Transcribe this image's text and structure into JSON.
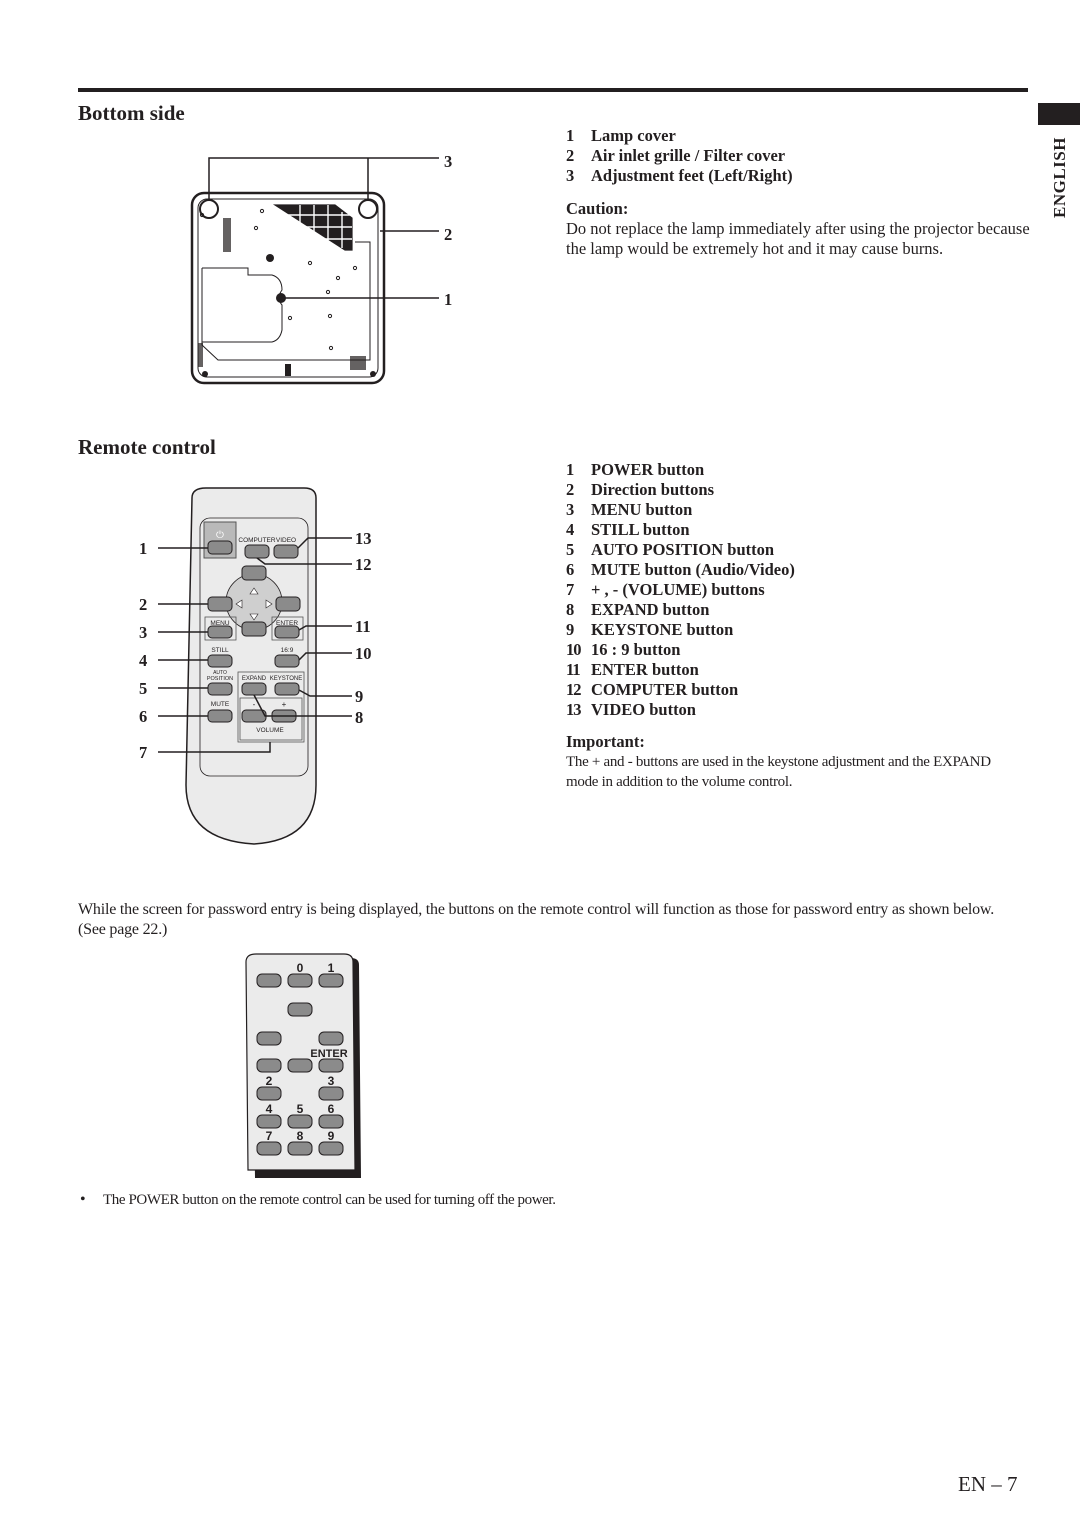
{
  "language_tab": "ENGLISH",
  "bottom_side": {
    "heading": "Bottom side",
    "callouts": [
      "1",
      "2",
      "3"
    ],
    "items": [
      {
        "num": "1",
        "label": "Lamp cover"
      },
      {
        "num": "2",
        "label": "Air inlet grille / Filter cover"
      },
      {
        "num": "3",
        "label": "Adjustment feet (Left/Right)"
      }
    ],
    "caution_heading": "Caution:",
    "caution_text": "Do not replace the lamp immediately after using the projector because the lamp would be extremely hot and it may cause burns."
  },
  "remote_control": {
    "heading": "Remote control",
    "left_callouts": [
      "1",
      "2",
      "3",
      "4",
      "5",
      "6",
      "7"
    ],
    "right_callouts": [
      "13",
      "12",
      "11",
      "10",
      "9",
      "8"
    ],
    "button_labels": {
      "computer": "COMPUTER",
      "video": "VIDEO",
      "menu": "MENU",
      "enter": "ENTER",
      "still": "STILL",
      "aspect": "16:9",
      "auto": "AUTO",
      "position": "POSITION",
      "expand": "EXPAND",
      "keystone": "KEYSTONE",
      "mute": "MUTE",
      "minus": "-",
      "plus": "+",
      "volume": "VOLUME"
    },
    "items": [
      {
        "num": "1",
        "label": "POWER button"
      },
      {
        "num": "2",
        "label": "Direction buttons"
      },
      {
        "num": "3",
        "label": "MENU button"
      },
      {
        "num": "4",
        "label": "STILL button"
      },
      {
        "num": "5",
        "label": "AUTO POSITION button"
      },
      {
        "num": "6",
        "label": "MUTE button (Audio/Video)"
      },
      {
        "num": "7",
        "label": "+ , - (VOLUME) buttons"
      },
      {
        "num": "8",
        "label": "EXPAND button"
      },
      {
        "num": "9",
        "label": "KEYSTONE button"
      },
      {
        "num": "10",
        "label": "16 : 9 button"
      },
      {
        "num": "11",
        "label": "ENTER button"
      },
      {
        "num": "12",
        "label": "COMPUTER button"
      },
      {
        "num": "13",
        "label": "VIDEO button"
      }
    ],
    "important_heading": "Important:",
    "important_text": "The + and - buttons are used in the keystone adjustment and the EXPAND mode in addition to the volume control."
  },
  "password": {
    "intro": "While the screen for password entry is being displayed, the buttons on the remote control will function as those for password entry as shown below. (See page 22.)",
    "keys": {
      "k0": "0",
      "k1": "1",
      "enter": "ENTER",
      "k2": "2",
      "k3": "3",
      "k4": "4",
      "k5": "5",
      "k6": "6",
      "k7": "7",
      "k8": "8",
      "k9": "9"
    },
    "bullet": "•",
    "note": "The POWER button on the remote control can be used for turning off the power."
  },
  "footer": {
    "page_number": "EN – 7"
  }
}
